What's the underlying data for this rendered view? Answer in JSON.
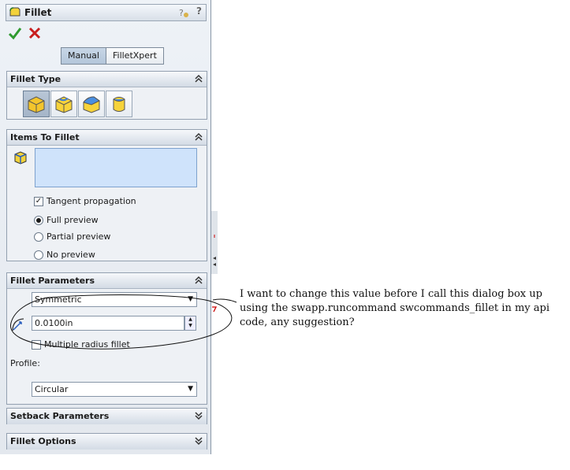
{
  "panel": {
    "title": "Fillet",
    "tabs": [
      {
        "label": "Manual",
        "active": true
      },
      {
        "label": "FilletXpert",
        "active": false
      }
    ]
  },
  "groups": {
    "fillet_type": {
      "title": "Fillet Type",
      "buttons": [
        "constant-radius",
        "variable-radius",
        "face-fillet",
        "full-round"
      ]
    },
    "items": {
      "title": "Items To Fillet",
      "tangent_propagation": "Tangent propagation",
      "full_preview": "Full preview",
      "partial_preview": "Partial preview",
      "no_preview": "No preview"
    },
    "params": {
      "title": "Fillet Parameters",
      "type_value": "Symmetric",
      "radius_value": "0.0100in",
      "multiple_radius": "Multiple radius fillet",
      "profile_label": "Profile:",
      "profile_value": "Circular"
    },
    "setback": {
      "title": "Setback Parameters"
    },
    "options": {
      "title": "Fillet Options"
    }
  },
  "note": {
    "text": "I want to change this value before I call this dialog box up using the swapp.runcommand swcommands_fillet in my api code, any suggestion?"
  },
  "colors": {
    "accent": "#cfe3fb",
    "ok_green": "#2f9a2f",
    "cancel_red": "#c81e1e"
  }
}
